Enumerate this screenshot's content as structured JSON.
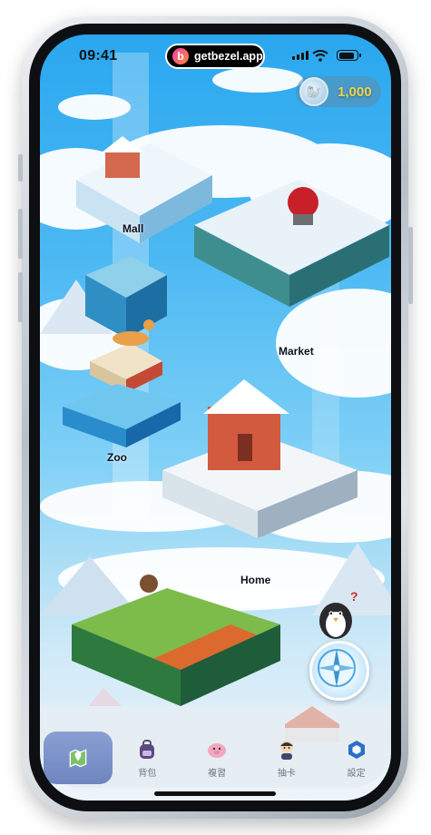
{
  "status_bar": {
    "time": "09:41",
    "url": "getbezel.app",
    "bezel_logo": "b"
  },
  "currency": {
    "amount": "1,000",
    "icon": "seal-coin-icon"
  },
  "map": {
    "locations": [
      {
        "id": "mall",
        "label": "Mall"
      },
      {
        "id": "market",
        "label": "Market"
      },
      {
        "id": "zoo",
        "label": "Zoo"
      },
      {
        "id": "home",
        "label": "Home"
      }
    ]
  },
  "help": {
    "mark": "?"
  },
  "tabs": [
    {
      "id": "map",
      "label": "",
      "icon": "map-pin-icon",
      "active": true
    },
    {
      "id": "bag",
      "label": "背包",
      "icon": "backpack-icon"
    },
    {
      "id": "study",
      "label": "複習",
      "icon": "piggy-icon"
    },
    {
      "id": "gacha",
      "label": "抽卡",
      "icon": "character-card-icon"
    },
    {
      "id": "settings",
      "label": "設定",
      "icon": "hexagon-settings-icon"
    }
  ],
  "colors": {
    "sky": "#2aa7ef",
    "coin_text": "#f0d64b",
    "tab_active": "#7a91c8"
  }
}
